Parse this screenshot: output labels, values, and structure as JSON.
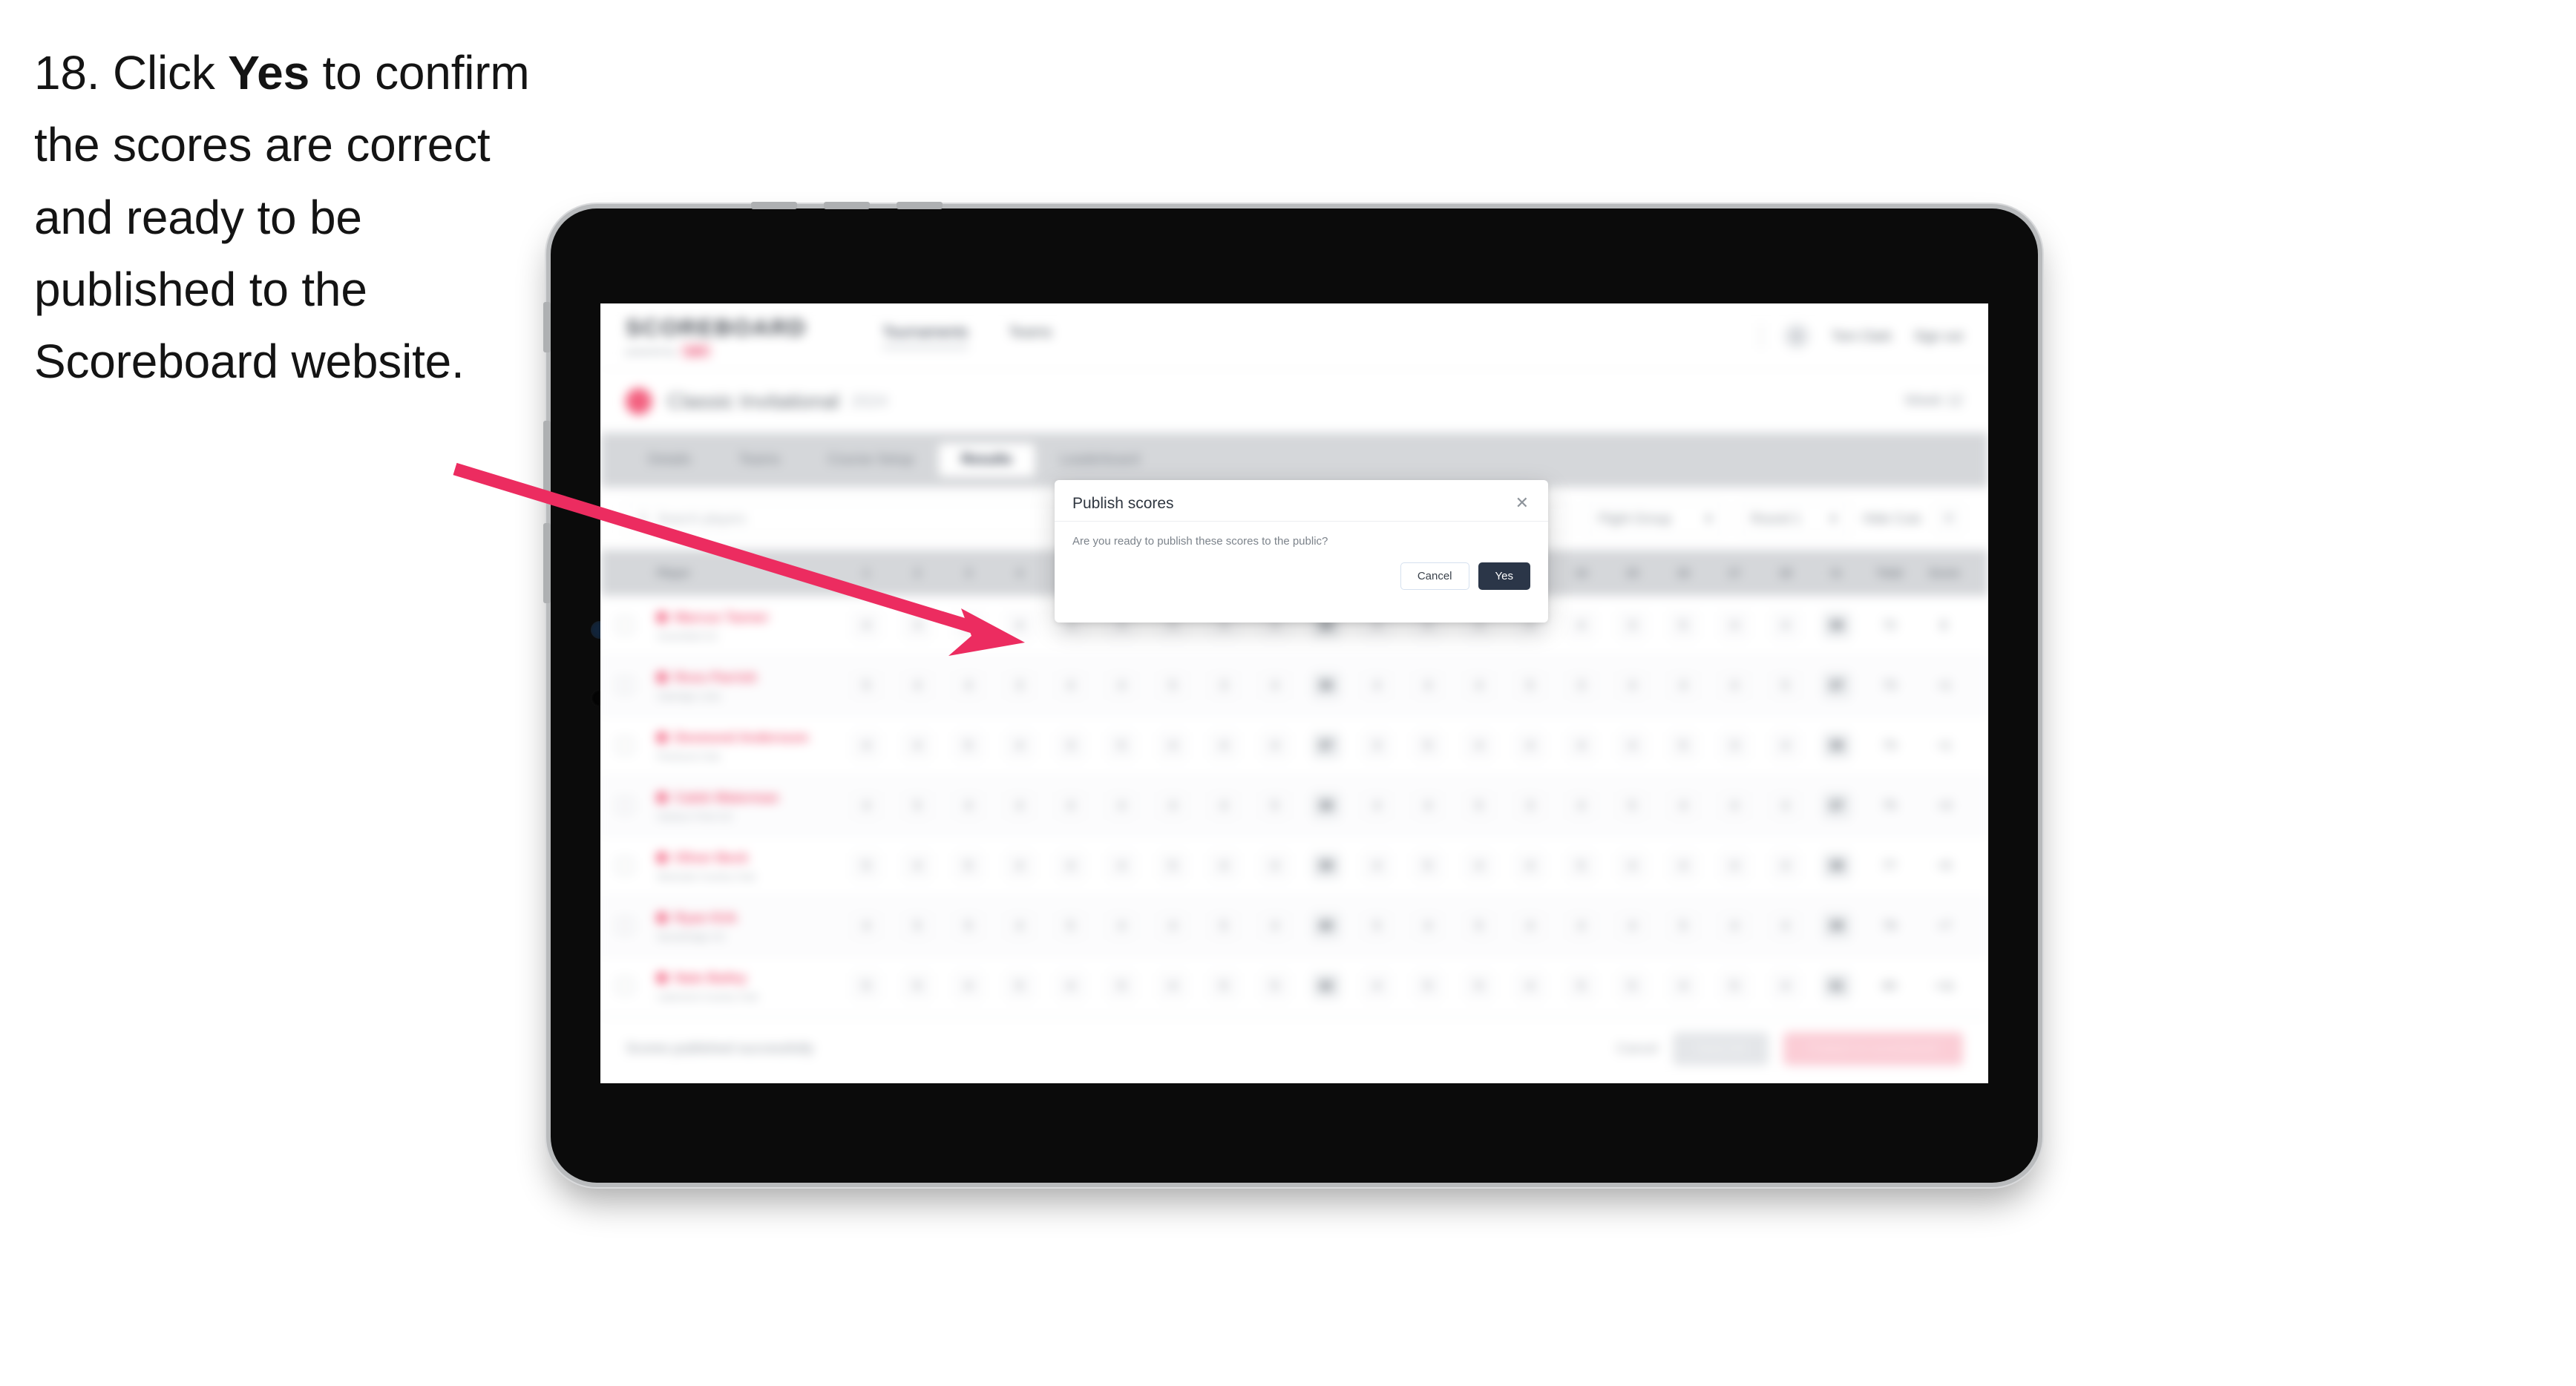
{
  "instruction": {
    "number": "18.",
    "pre": "Click ",
    "bold": "Yes",
    "post": " to confirm the scores are correct and ready to be published to the Scoreboard website."
  },
  "colors": {
    "accent_pink": "#f3607f",
    "arrow_pink": "#ec2c60",
    "modal_primary": "#2b3648",
    "bezel_black": "#0b0b0b",
    "frame_silver": "#b9bbbd",
    "tab_bar_grey": "#d5d7da"
  },
  "app": {
    "header": {
      "brand": "SCOREBOARD",
      "brand_sub": "powered by",
      "brand_chip": "golf",
      "nav": [
        {
          "label": "Tournaments",
          "active": true
        },
        {
          "label": "Teams",
          "active": false
        }
      ],
      "avatar_icon": "user-icon",
      "user_name": "Tom Clark",
      "sign_out": "Sign out"
    },
    "event": {
      "logo_icon": "event-logo-icon",
      "title": "Classic Invitational",
      "tag": "2024",
      "right_label": "Week 12"
    },
    "tabs": [
      {
        "label": "Details",
        "active": false
      },
      {
        "label": "Teams",
        "active": false
      },
      {
        "label": "Course Setup",
        "active": false
      },
      {
        "label": "Results",
        "active": true
      },
      {
        "label": "Leaderboard",
        "active": false
      }
    ],
    "filters": {
      "search_placeholder": "Search players",
      "search_icon": "search-icon",
      "select_flight": "Flight Group",
      "select_round": "Round 1",
      "link_label": "Hide Cuts",
      "settings_icon": "settings-icon",
      "chevron_icon": "chevron-down-icon"
    },
    "table": {
      "columns": {
        "player": "Player",
        "holes": [
          "1",
          "2",
          "3",
          "4",
          "5",
          "6",
          "7",
          "8",
          "9",
          "Out",
          "10",
          "11",
          "12",
          "13",
          "14",
          "15",
          "16",
          "17",
          "18",
          "In"
        ],
        "tail": [
          "Total",
          "Score"
        ]
      },
      "rows": [
        {
          "name": "Marcus Tanner",
          "sub": "Greenfield GC",
          "scores": [
            "4",
            "3",
            "5",
            "4",
            "3",
            "4",
            "5",
            "4",
            "4",
            "36",
            "4",
            "5",
            "3",
            "4",
            "4",
            "3",
            "5",
            "4",
            "4",
            "36"
          ],
          "total": "72",
          "score": "E"
        },
        {
          "name": "Ross Parrish",
          "sub": "Oakridge Links",
          "scores": [
            "5",
            "4",
            "4",
            "3",
            "4",
            "4",
            "5",
            "3",
            "4",
            "36",
            "4",
            "4",
            "4",
            "5",
            "3",
            "4",
            "4",
            "4",
            "5",
            "37"
          ],
          "total": "73",
          "score": "+1"
        },
        {
          "name": "Desmond Andersson",
          "sub": "Pinehurst Club",
          "scores": [
            "4",
            "4",
            "5",
            "4",
            "3",
            "5",
            "4",
            "4",
            "4",
            "37",
            "3",
            "5",
            "4",
            "4",
            "4",
            "4",
            "5",
            "3",
            "4",
            "36"
          ],
          "total": "73",
          "score": "+1"
        },
        {
          "name": "Caleb Waterman",
          "sub": "Harbour Point GC",
          "scores": [
            "4",
            "5",
            "4",
            "4",
            "4",
            "4",
            "4",
            "4",
            "5",
            "38",
            "4",
            "4",
            "5",
            "3",
            "4",
            "5",
            "4",
            "4",
            "4",
            "37"
          ],
          "total": "75",
          "score": "+3"
        },
        {
          "name": "Oliver Beck",
          "sub": "Westvale Country Club",
          "scores": [
            "5",
            "4",
            "5",
            "4",
            "4",
            "4",
            "5",
            "4",
            "4",
            "39",
            "4",
            "5",
            "4",
            "4",
            "5",
            "4",
            "4",
            "4",
            "4",
            "38"
          ],
          "total": "77",
          "score": "+5"
        },
        {
          "name": "Ryan Kirk",
          "sub": "Stonebridge GC",
          "scores": [
            "4",
            "5",
            "5",
            "4",
            "5",
            "4",
            "4",
            "5",
            "4",
            "40",
            "5",
            "4",
            "5",
            "4",
            "4",
            "4",
            "5",
            "4",
            "4",
            "39"
          ],
          "total": "79",
          "score": "+7"
        },
        {
          "name": "Nate Bailey",
          "sub": "Lakemont Country Club",
          "scores": [
            "5",
            "5",
            "4",
            "5",
            "4",
            "5",
            "4",
            "5",
            "5",
            "42",
            "4",
            "5",
            "5",
            "4",
            "5",
            "5",
            "4",
            "5",
            "4",
            "41"
          ],
          "total": "83",
          "score": "+11"
        }
      ]
    },
    "bottom": {
      "note": "Scores published successfully",
      "link": "Cancel",
      "secondary": "Save All",
      "primary": "Publish to scoreboard"
    }
  },
  "modal": {
    "title": "Publish scores",
    "close_icon": "close-icon",
    "message": "Are you ready to publish these scores to the public?",
    "cancel_label": "Cancel",
    "yes_label": "Yes"
  },
  "annotation": {
    "arrow_name": "callout-arrow"
  }
}
